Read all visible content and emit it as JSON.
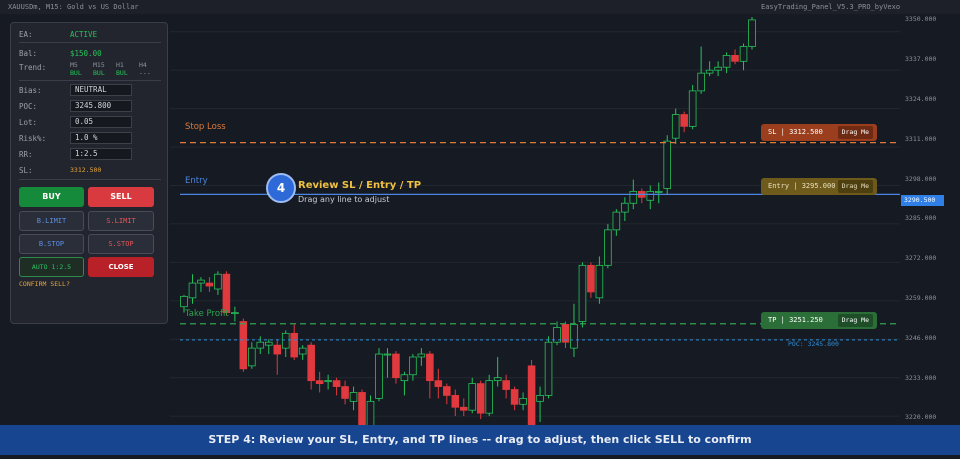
{
  "header": {
    "symbol_title": "XAUUSDm, M15:  Gold vs US Dollar",
    "panel_title": "EasyTrading_Panel_V5.3_PRO_byVexo"
  },
  "panel": {
    "ea_label": "EA:",
    "ea_status": "ACTIVE",
    "bal_label": "Bal:",
    "bal_value": "$150.00",
    "trend_label": "Trend:",
    "trend": [
      {
        "tf": "M5",
        "dir": "BUL"
      },
      {
        "tf": "M15",
        "dir": "BUL"
      },
      {
        "tf": "H1",
        "dir": "BUL"
      },
      {
        "tf": "H4",
        "dir": "---"
      }
    ],
    "bias_label": "Bias:",
    "bias_value": "NEUTRAL",
    "poc_label": "POC:",
    "poc_value": "3245.800",
    "lot_label": "Lot:",
    "lot_value": "0.05",
    "risk_label": "Risk%:",
    "risk_value": "1.0  %",
    "rr_label": "RR:",
    "rr_value": "1:2.5",
    "sl_label": "SL:",
    "sl_value": "3312.500",
    "buy_label": "BUY",
    "sell_label": "SELL",
    "blimit_label": "B.LIMIT",
    "slimit_label": "S.LIMIT",
    "bstop_label": "B.STOP",
    "sstop_label": "S.STOP",
    "auto_label": "AUTO 1:2.5",
    "close_label": "CLOSE",
    "confirm_text": "CONFIRM SELL?"
  },
  "lines": {
    "stop_loss_label": "Stop Loss",
    "entry_label": "Entry",
    "take_profit_label": "Take Profit",
    "sl_price": 3312.5,
    "entry_price": 3295.0,
    "tp_price": 3251.25,
    "poc_price": 3245.8
  },
  "tags": {
    "sl_text": "SL  |  3312.500",
    "entry_text": "Entry  |  3295.000",
    "tp_text": "TP  |  3251.250",
    "drag_text": "Drag Me"
  },
  "step": {
    "number": "4",
    "title": "Review SL / Entry / TP",
    "subtitle": "Drag any line to adjust",
    "footer": "STEP 4:  Review your SL, Entry, and TP lines -- drag to adjust, then click SELL to confirm"
  },
  "price_scale": {
    "ticks": [
      "3350.000",
      "3337.000",
      "3324.000",
      "3311.000",
      "3298.000",
      "3285.000",
      "3272.000",
      "3259.000",
      "3246.000",
      "3233.000",
      "3220.000"
    ],
    "current_price": "3290.500",
    "poc_text": "POC: 3245.800"
  },
  "colors": {
    "bull": "#26c35a",
    "bear": "#e0393e",
    "sl_line": "#e07a3a",
    "entry_line": "#4a86e0",
    "tp_line": "#2fa44f",
    "poc_line": "#2b8fd8"
  },
  "chart_data": {
    "type": "candlestick",
    "title": "XAUUSDm, M15:  Gold vs US Dollar",
    "ylim": [
      3217,
      3356
    ],
    "candles": [
      {
        "o": 3257,
        "c": 3260.5,
        "h": 3261,
        "l": 3255
      },
      {
        "o": 3260,
        "c": 3265,
        "h": 3268,
        "l": 3258
      },
      {
        "o": 3265,
        "c": 3266,
        "h": 3267,
        "l": 3262
      },
      {
        "o": 3265,
        "c": 3264,
        "h": 3267,
        "l": 3262
      },
      {
        "o": 3263,
        "c": 3268,
        "h": 3269,
        "l": 3261
      },
      {
        "o": 3268,
        "c": 3255,
        "h": 3269,
        "l": 3254
      },
      {
        "o": 3255,
        "c": 3255,
        "h": 3257,
        "l": 3252
      },
      {
        "o": 3252,
        "c": 3236,
        "h": 3253,
        "l": 3235
      },
      {
        "o": 3237,
        "c": 3243,
        "h": 3245,
        "l": 3236
      },
      {
        "o": 3243,
        "c": 3245,
        "h": 3247,
        "l": 3241
      },
      {
        "o": 3244,
        "c": 3245,
        "h": 3246,
        "l": 3241
      },
      {
        "o": 3244,
        "c": 3241,
        "h": 3246,
        "l": 3234
      },
      {
        "o": 3243,
        "c": 3248,
        "h": 3249,
        "l": 3240
      },
      {
        "o": 3248,
        "c": 3240,
        "h": 3251,
        "l": 3239
      },
      {
        "o": 3241,
        "c": 3243,
        "h": 3244,
        "l": 3239
      },
      {
        "o": 3244,
        "c": 3232,
        "h": 3245,
        "l": 3229
      },
      {
        "o": 3232,
        "c": 3231,
        "h": 3235,
        "l": 3228
      },
      {
        "o": 3232,
        "c": 3232,
        "h": 3234,
        "l": 3229
      },
      {
        "o": 3232,
        "c": 3230,
        "h": 3233,
        "l": 3227
      },
      {
        "o": 3230,
        "c": 3226,
        "h": 3232,
        "l": 3224
      },
      {
        "o": 3225,
        "c": 3228,
        "h": 3230,
        "l": 3222
      },
      {
        "o": 3228,
        "c": 3215,
        "h": 3229,
        "l": 3213
      },
      {
        "o": 3216,
        "c": 3225,
        "h": 3227,
        "l": 3214
      },
      {
        "o": 3226,
        "c": 3241,
        "h": 3243,
        "l": 3225
      },
      {
        "o": 3241,
        "c": 3241,
        "h": 3243,
        "l": 3233
      },
      {
        "o": 3241,
        "c": 3233,
        "h": 3242,
        "l": 3231
      },
      {
        "o": 3232,
        "c": 3234,
        "h": 3235,
        "l": 3227
      },
      {
        "o": 3234,
        "c": 3240,
        "h": 3241,
        "l": 3232
      },
      {
        "o": 3240,
        "c": 3241,
        "h": 3243,
        "l": 3237
      },
      {
        "o": 3241,
        "c": 3232,
        "h": 3242,
        "l": 3226
      },
      {
        "o": 3232,
        "c": 3230,
        "h": 3236,
        "l": 3226
      },
      {
        "o": 3230,
        "c": 3227,
        "h": 3231,
        "l": 3224
      },
      {
        "o": 3227,
        "c": 3223,
        "h": 3229,
        "l": 3220
      },
      {
        "o": 3223,
        "c": 3222,
        "h": 3226,
        "l": 3220
      },
      {
        "o": 3222,
        "c": 3231,
        "h": 3233,
        "l": 3221
      },
      {
        "o": 3231,
        "c": 3221,
        "h": 3232,
        "l": 3219
      },
      {
        "o": 3221,
        "c": 3232,
        "h": 3234,
        "l": 3220
      },
      {
        "o": 3232,
        "c": 3233,
        "h": 3240,
        "l": 3230
      },
      {
        "o": 3232,
        "c": 3229,
        "h": 3234,
        "l": 3226
      },
      {
        "o": 3229,
        "c": 3224,
        "h": 3230,
        "l": 3222
      },
      {
        "o": 3224,
        "c": 3226,
        "h": 3228,
        "l": 3222
      },
      {
        "o": 3237,
        "c": 3212,
        "h": 3239,
        "l": 3210
      },
      {
        "o": 3225,
        "c": 3227,
        "h": 3230,
        "l": 3218
      },
      {
        "o": 3227,
        "c": 3245,
        "h": 3247,
        "l": 3226
      },
      {
        "o": 3245,
        "c": 3250,
        "h": 3252,
        "l": 3244
      },
      {
        "o": 3251,
        "c": 3245,
        "h": 3252,
        "l": 3243
      },
      {
        "o": 3243,
        "c": 3251,
        "h": 3258,
        "l": 3240
      },
      {
        "o": 3252,
        "c": 3271,
        "h": 3272,
        "l": 3250
      },
      {
        "o": 3271,
        "c": 3262,
        "h": 3272,
        "l": 3260
      },
      {
        "o": 3260,
        "c": 3271,
        "h": 3274,
        "l": 3258
      },
      {
        "o": 3271,
        "c": 3283,
        "h": 3285,
        "l": 3270
      },
      {
        "o": 3283,
        "c": 3289,
        "h": 3290,
        "l": 3281
      },
      {
        "o": 3289,
        "c": 3292,
        "h": 3294,
        "l": 3286
      },
      {
        "o": 3292,
        "c": 3296,
        "h": 3300,
        "l": 3290
      },
      {
        "o": 3296,
        "c": 3294,
        "h": 3297,
        "l": 3292
      },
      {
        "o": 3293,
        "c": 3296,
        "h": 3298,
        "l": 3290
      },
      {
        "o": 3296,
        "c": 3296,
        "h": 3299,
        "l": 3292
      },
      {
        "o": 3297,
        "c": 3313,
        "h": 3315,
        "l": 3295
      },
      {
        "o": 3314,
        "c": 3322,
        "h": 3324,
        "l": 3312
      },
      {
        "o": 3322,
        "c": 3318,
        "h": 3323,
        "l": 3316
      },
      {
        "o": 3318,
        "c": 3330,
        "h": 3332,
        "l": 3317
      },
      {
        "o": 3330,
        "c": 3336,
        "h": 3345,
        "l": 3329
      },
      {
        "o": 3336,
        "c": 3337,
        "h": 3340,
        "l": 3335
      },
      {
        "o": 3337,
        "c": 3338,
        "h": 3340,
        "l": 3335
      },
      {
        "o": 3338,
        "c": 3342,
        "h": 3343,
        "l": 3336
      },
      {
        "o": 3342,
        "c": 3340,
        "h": 3344,
        "l": 3339
      },
      {
        "o": 3340,
        "c": 3345,
        "h": 3346,
        "l": 3337
      },
      {
        "o": 3345,
        "c": 3354,
        "h": 3355,
        "l": 3344
      }
    ]
  }
}
